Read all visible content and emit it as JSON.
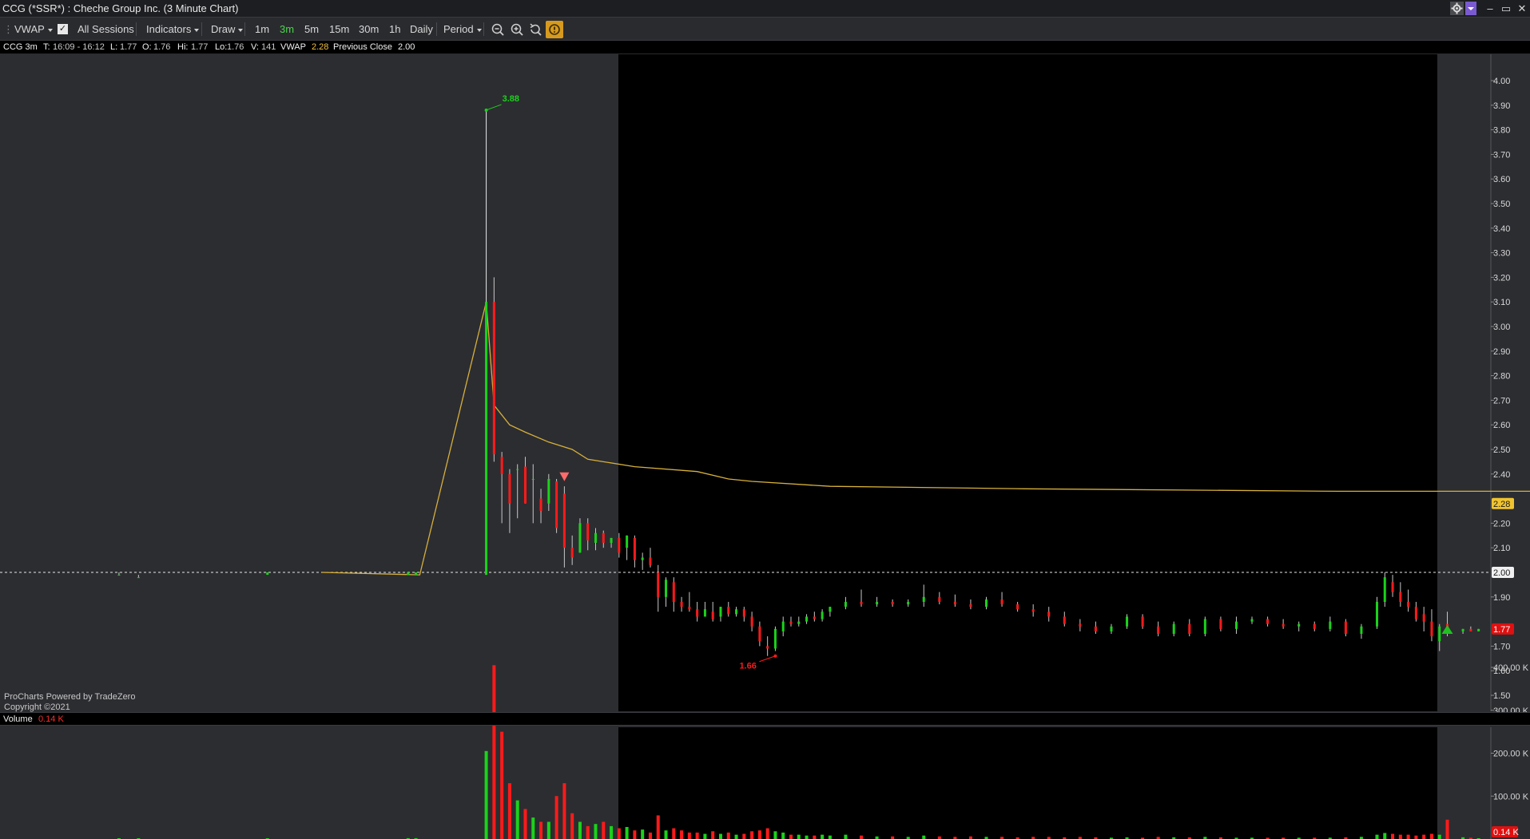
{
  "window": {
    "title": "CCG (*SSR*) : Cheche Group Inc. (3 Minute Chart)",
    "minimize": "–",
    "restore": "▭",
    "close": "✕"
  },
  "toolbar": {
    "vwap": "VWAP",
    "all_sessions": "All Sessions",
    "all_sessions_checked": true,
    "indicators": "Indicators",
    "draw": "Draw",
    "timeframes": [
      "1m",
      "3m",
      "5m",
      "15m",
      "30m",
      "1h",
      "Daily"
    ],
    "active_timeframe": "3m",
    "period": "Period"
  },
  "infobar": {
    "symbol": "CCG 3m",
    "t_label": "T:",
    "t_value": "16:09 - 16:12",
    "l_label": "L:",
    "l_value": "1.77",
    "o_label": "O:",
    "o_value": "1.76",
    "hi_label": "Hi:",
    "hi_value": "1.77",
    "lo_label": "Lo:",
    "lo_value": "1.76",
    "v_label": "V:",
    "v_value": "141",
    "vwap_label": "VWAP",
    "vwap_value": "2.28",
    "prev_close_label": "Previous Close",
    "prev_close_value": "2.00"
  },
  "watermark": {
    "line1": "ProCharts Powered by TradeZero",
    "line2": "Copyright ©2021"
  },
  "volume_header": {
    "label": "Volume",
    "value": "0.14 K"
  },
  "chart_data": {
    "type": "candlestick",
    "price_axis": {
      "ticks": [
        "4.00",
        "3.90",
        "3.80",
        "3.70",
        "3.60",
        "3.50",
        "3.40",
        "3.30",
        "3.20",
        "3.10",
        "3.00",
        "2.90",
        "2.80",
        "2.70",
        "2.60",
        "2.50",
        "2.40",
        "2.30",
        "2.20",
        "2.10",
        "2.00",
        "1.90",
        "1.80",
        "1.70",
        "1.60",
        "1.50"
      ],
      "ylim": [
        1.46,
        4.06
      ]
    },
    "volume_axis": {
      "ticks": [
        "400.00 K",
        "300.00 K",
        "200.00 K",
        "100.00 K"
      ],
      "ylim": [
        0,
        430
      ]
    },
    "badges": {
      "vwap": "2.28",
      "previous_close": "2.00",
      "last": "1.77",
      "last_volume": "0.14 K"
    },
    "annotations": {
      "high_label": "3.88",
      "low_label": "1.66"
    },
    "colors": {
      "up": "#1ad31a",
      "down": "#ff1a1a",
      "vwap": "#d7b03a",
      "premarket_bg": "#2c2d31",
      "session_bg": "#000000"
    },
    "vwap_line": [
      [
        0,
        2.0
      ],
      [
        40,
        2.0
      ],
      [
        80,
        2.0
      ],
      [
        105,
        1.99
      ],
      [
        122,
        3.1
      ],
      [
        124,
        2.68
      ],
      [
        128,
        2.6
      ],
      [
        132,
        2.57
      ],
      [
        138,
        2.53
      ],
      [
        144,
        2.5
      ],
      [
        148,
        2.46
      ],
      [
        160,
        2.43
      ],
      [
        176,
        2.41
      ],
      [
        184,
        2.38
      ],
      [
        190,
        2.37
      ],
      [
        210,
        2.35
      ],
      [
        260,
        2.34
      ],
      [
        340,
        2.33
      ],
      [
        420,
        2.33
      ],
      [
        470,
        2.32
      ],
      [
        540,
        2.31
      ],
      [
        560,
        2.3
      ],
      [
        566,
        2.28
      ],
      [
        576,
        2.28
      ]
    ],
    "prev_close_line": 2.0,
    "bars": [
      {
        "i": 28,
        "o": 1.99,
        "h": 2.0,
        "l": 1.99,
        "c": 1.99,
        "v": 1
      },
      {
        "i": 33,
        "o": 1.98,
        "h": 1.99,
        "l": 1.98,
        "c": 1.98,
        "v": 1
      },
      {
        "i": 66,
        "o": 1.99,
        "h": 2.0,
        "l": 1.99,
        "c": 2.0,
        "v": 1
      },
      {
        "i": 102,
        "o": 1.99,
        "h": 2.0,
        "l": 1.99,
        "c": 2.0,
        "v": 2
      },
      {
        "i": 104,
        "o": 1.99,
        "h": 2.0,
        "l": 1.99,
        "c": 2.0,
        "v": 2
      },
      {
        "i": 122,
        "o": 1.99,
        "h": 3.88,
        "l": 1.99,
        "c": 3.1,
        "v": 205
      },
      {
        "i": 124,
        "o": 3.1,
        "h": 3.2,
        "l": 2.45,
        "c": 2.48,
        "v": 405
      },
      {
        "i": 126,
        "o": 2.47,
        "h": 2.49,
        "l": 2.2,
        "c": 2.4,
        "v": 250
      },
      {
        "i": 128,
        "o": 2.4,
        "h": 2.42,
        "l": 2.16,
        "c": 2.28,
        "v": 130
      },
      {
        "i": 130,
        "o": 2.42,
        "h": 2.44,
        "l": 2.22,
        "c": 2.42,
        "v": 90
      },
      {
        "i": 132,
        "o": 2.43,
        "h": 2.47,
        "l": 2.28,
        "c": 2.28,
        "v": 70
      },
      {
        "i": 134,
        "o": 2.38,
        "h": 2.44,
        "l": 2.2,
        "c": 2.38,
        "v": 50
      },
      {
        "i": 136,
        "o": 2.3,
        "h": 2.34,
        "l": 2.2,
        "c": 2.25,
        "v": 40
      },
      {
        "i": 138,
        "o": 2.28,
        "h": 2.4,
        "l": 2.25,
        "c": 2.38,
        "v": 40
      },
      {
        "i": 140,
        "o": 2.37,
        "h": 2.38,
        "l": 2.16,
        "c": 2.18,
        "v": 100
      },
      {
        "i": 142,
        "o": 2.32,
        "h": 2.35,
        "l": 2.02,
        "c": 2.1,
        "v": 130
      },
      {
        "i": 144,
        "o": 2.1,
        "h": 2.15,
        "l": 2.03,
        "c": 2.06,
        "v": 60
      },
      {
        "i": 146,
        "o": 2.08,
        "h": 2.22,
        "l": 2.08,
        "c": 2.2,
        "v": 40
      },
      {
        "i": 148,
        "o": 2.2,
        "h": 2.22,
        "l": 2.09,
        "c": 2.13,
        "v": 30
      },
      {
        "i": 150,
        "o": 2.12,
        "h": 2.18,
        "l": 2.09,
        "c": 2.16,
        "v": 35
      },
      {
        "i": 152,
        "o": 2.16,
        "h": 2.17,
        "l": 2.1,
        "c": 2.12,
        "v": 40
      },
      {
        "i": 154,
        "o": 2.12,
        "h": 2.14,
        "l": 2.1,
        "c": 2.14,
        "v": 30
      },
      {
        "i": 156,
        "o": 2.14,
        "h": 2.16,
        "l": 2.06,
        "c": 2.08,
        "v": 25
      },
      {
        "i": 158,
        "o": 2.1,
        "h": 2.15,
        "l": 2.05,
        "c": 2.15,
        "v": 28
      },
      {
        "i": 160,
        "o": 2.14,
        "h": 2.15,
        "l": 2.02,
        "c": 2.05,
        "v": 20
      },
      {
        "i": 162,
        "o": 2.05,
        "h": 2.08,
        "l": 2.01,
        "c": 2.06,
        "v": 22
      },
      {
        "i": 164,
        "o": 2.06,
        "h": 2.1,
        "l": 2.02,
        "c": 2.03,
        "v": 15
      },
      {
        "i": 166,
        "o": 2.0,
        "h": 2.03,
        "l": 1.84,
        "c": 1.9,
        "v": 55
      },
      {
        "i": 168,
        "o": 1.9,
        "h": 1.98,
        "l": 1.86,
        "c": 1.97,
        "v": 20
      },
      {
        "i": 170,
        "o": 1.96,
        "h": 1.98,
        "l": 1.84,
        "c": 1.88,
        "v": 25
      },
      {
        "i": 172,
        "o": 1.88,
        "h": 1.9,
        "l": 1.84,
        "c": 1.86,
        "v": 20
      },
      {
        "i": 174,
        "o": 1.86,
        "h": 1.92,
        "l": 1.84,
        "c": 1.85,
        "v": 15
      },
      {
        "i": 176,
        "o": 1.85,
        "h": 1.88,
        "l": 1.8,
        "c": 1.82,
        "v": 15
      },
      {
        "i": 178,
        "o": 1.82,
        "h": 1.88,
        "l": 1.82,
        "c": 1.85,
        "v": 12
      },
      {
        "i": 180,
        "o": 1.84,
        "h": 1.88,
        "l": 1.8,
        "c": 1.81,
        "v": 18
      },
      {
        "i": 182,
        "o": 1.82,
        "h": 1.86,
        "l": 1.8,
        "c": 1.86,
        "v": 12
      },
      {
        "i": 184,
        "o": 1.86,
        "h": 1.88,
        "l": 1.82,
        "c": 1.83,
        "v": 15
      },
      {
        "i": 186,
        "o": 1.83,
        "h": 1.86,
        "l": 1.82,
        "c": 1.85,
        "v": 10
      },
      {
        "i": 188,
        "o": 1.85,
        "h": 1.86,
        "l": 1.8,
        "c": 1.82,
        "v": 12
      },
      {
        "i": 190,
        "o": 1.82,
        "h": 1.84,
        "l": 1.76,
        "c": 1.78,
        "v": 18
      },
      {
        "i": 192,
        "o": 1.78,
        "h": 1.8,
        "l": 1.7,
        "c": 1.72,
        "v": 20
      },
      {
        "i": 194,
        "o": 1.7,
        "h": 1.74,
        "l": 1.66,
        "c": 1.69,
        "v": 25
      },
      {
        "i": 196,
        "o": 1.69,
        "h": 1.78,
        "l": 1.68,
        "c": 1.77,
        "v": 18
      },
      {
        "i": 198,
        "o": 1.76,
        "h": 1.82,
        "l": 1.74,
        "c": 1.8,
        "v": 15
      },
      {
        "i": 200,
        "o": 1.8,
        "h": 1.82,
        "l": 1.78,
        "c": 1.79,
        "v": 10
      },
      {
        "i": 202,
        "o": 1.79,
        "h": 1.82,
        "l": 1.78,
        "c": 1.8,
        "v": 10
      },
      {
        "i": 204,
        "o": 1.8,
        "h": 1.83,
        "l": 1.79,
        "c": 1.82,
        "v": 8
      },
      {
        "i": 206,
        "o": 1.82,
        "h": 1.84,
        "l": 1.8,
        "c": 1.81,
        "v": 8
      },
      {
        "i": 208,
        "o": 1.81,
        "h": 1.85,
        "l": 1.8,
        "c": 1.84,
        "v": 10
      },
      {
        "i": 210,
        "o": 1.84,
        "h": 1.86,
        "l": 1.82,
        "c": 1.86,
        "v": 8
      },
      {
        "i": 214,
        "o": 1.86,
        "h": 1.9,
        "l": 1.85,
        "c": 1.88,
        "v": 10
      },
      {
        "i": 218,
        "o": 1.88,
        "h": 1.93,
        "l": 1.86,
        "c": 1.87,
        "v": 8
      },
      {
        "i": 222,
        "o": 1.87,
        "h": 1.9,
        "l": 1.86,
        "c": 1.88,
        "v": 6
      },
      {
        "i": 226,
        "o": 1.88,
        "h": 1.89,
        "l": 1.86,
        "c": 1.87,
        "v": 6
      },
      {
        "i": 230,
        "o": 1.87,
        "h": 1.89,
        "l": 1.86,
        "c": 1.88,
        "v": 5
      },
      {
        "i": 234,
        "o": 1.88,
        "h": 1.95,
        "l": 1.86,
        "c": 1.9,
        "v": 8
      },
      {
        "i": 238,
        "o": 1.9,
        "h": 1.92,
        "l": 1.87,
        "c": 1.88,
        "v": 6
      },
      {
        "i": 242,
        "o": 1.88,
        "h": 1.91,
        "l": 1.86,
        "c": 1.87,
        "v": 5
      },
      {
        "i": 246,
        "o": 1.87,
        "h": 1.89,
        "l": 1.85,
        "c": 1.86,
        "v": 6
      },
      {
        "i": 250,
        "o": 1.86,
        "h": 1.9,
        "l": 1.85,
        "c": 1.89,
        "v": 5
      },
      {
        "i": 254,
        "o": 1.89,
        "h": 1.92,
        "l": 1.86,
        "c": 1.87,
        "v": 5
      },
      {
        "i": 258,
        "o": 1.87,
        "h": 1.88,
        "l": 1.84,
        "c": 1.85,
        "v": 4
      },
      {
        "i": 262,
        "o": 1.85,
        "h": 1.87,
        "l": 1.82,
        "c": 1.84,
        "v": 5
      },
      {
        "i": 266,
        "o": 1.84,
        "h": 1.86,
        "l": 1.8,
        "c": 1.82,
        "v": 5
      },
      {
        "i": 270,
        "o": 1.82,
        "h": 1.84,
        "l": 1.78,
        "c": 1.79,
        "v": 4
      },
      {
        "i": 274,
        "o": 1.79,
        "h": 1.81,
        "l": 1.76,
        "c": 1.78,
        "v": 5
      },
      {
        "i": 278,
        "o": 1.78,
        "h": 1.8,
        "l": 1.75,
        "c": 1.76,
        "v": 4
      },
      {
        "i": 282,
        "o": 1.76,
        "h": 1.79,
        "l": 1.75,
        "c": 1.78,
        "v": 3
      },
      {
        "i": 286,
        "o": 1.78,
        "h": 1.83,
        "l": 1.77,
        "c": 1.82,
        "v": 4
      },
      {
        "i": 290,
        "o": 1.82,
        "h": 1.83,
        "l": 1.77,
        "c": 1.78,
        "v": 3
      },
      {
        "i": 294,
        "o": 1.78,
        "h": 1.8,
        "l": 1.74,
        "c": 1.75,
        "v": 5
      },
      {
        "i": 298,
        "o": 1.75,
        "h": 1.8,
        "l": 1.74,
        "c": 1.79,
        "v": 4
      },
      {
        "i": 302,
        "o": 1.79,
        "h": 1.81,
        "l": 1.74,
        "c": 1.75,
        "v": 4
      },
      {
        "i": 306,
        "o": 1.75,
        "h": 1.82,
        "l": 1.74,
        "c": 1.81,
        "v": 5
      },
      {
        "i": 310,
        "o": 1.81,
        "h": 1.82,
        "l": 1.76,
        "c": 1.77,
        "v": 4
      },
      {
        "i": 314,
        "o": 1.77,
        "h": 1.82,
        "l": 1.75,
        "c": 1.8,
        "v": 3
      },
      {
        "i": 318,
        "o": 1.8,
        "h": 1.82,
        "l": 1.79,
        "c": 1.81,
        "v": 3
      },
      {
        "i": 322,
        "o": 1.81,
        "h": 1.82,
        "l": 1.78,
        "c": 1.79,
        "v": 3
      },
      {
        "i": 326,
        "o": 1.79,
        "h": 1.81,
        "l": 1.77,
        "c": 1.78,
        "v": 3
      },
      {
        "i": 330,
        "o": 1.78,
        "h": 1.8,
        "l": 1.76,
        "c": 1.79,
        "v": 3
      },
      {
        "i": 334,
        "o": 1.79,
        "h": 1.8,
        "l": 1.76,
        "c": 1.77,
        "v": 3
      },
      {
        "i": 338,
        "o": 1.77,
        "h": 1.82,
        "l": 1.76,
        "c": 1.8,
        "v": 3
      },
      {
        "i": 342,
        "o": 1.8,
        "h": 1.81,
        "l": 1.74,
        "c": 1.75,
        "v": 4
      },
      {
        "i": 346,
        "o": 1.75,
        "h": 1.79,
        "l": 1.73,
        "c": 1.78,
        "v": 5
      },
      {
        "i": 350,
        "o": 1.78,
        "h": 1.9,
        "l": 1.77,
        "c": 1.88,
        "v": 10
      },
      {
        "i": 352,
        "o": 1.88,
        "h": 2.0,
        "l": 1.86,
        "c": 1.98,
        "v": 14
      },
      {
        "i": 354,
        "o": 1.96,
        "h": 1.99,
        "l": 1.9,
        "c": 1.92,
        "v": 12
      },
      {
        "i": 356,
        "o": 1.92,
        "h": 1.96,
        "l": 1.86,
        "c": 1.88,
        "v": 10
      },
      {
        "i": 358,
        "o": 1.88,
        "h": 1.93,
        "l": 1.84,
        "c": 1.86,
        "v": 10
      },
      {
        "i": 360,
        "o": 1.86,
        "h": 1.88,
        "l": 1.8,
        "c": 1.81,
        "v": 8
      },
      {
        "i": 362,
        "o": 1.83,
        "h": 1.86,
        "l": 1.76,
        "c": 1.8,
        "v": 10
      },
      {
        "i": 364,
        "o": 1.8,
        "h": 1.85,
        "l": 1.72,
        "c": 1.74,
        "v": 12
      },
      {
        "i": 366,
        "o": 1.72,
        "h": 1.79,
        "l": 1.68,
        "c": 1.78,
        "v": 10
      },
      {
        "i": 368,
        "o": 1.79,
        "h": 1.84,
        "l": 1.74,
        "c": 1.75,
        "v": 45
      },
      {
        "i": 372,
        "o": 1.76,
        "h": 1.77,
        "l": 1.75,
        "c": 1.77,
        "v": 4
      },
      {
        "i": 374,
        "o": 1.77,
        "h": 1.78,
        "l": 1.76,
        "c": 1.76,
        "v": 3
      },
      {
        "i": 376,
        "o": 1.76,
        "h": 1.77,
        "l": 1.76,
        "c": 1.77,
        "v": 1
      }
    ]
  }
}
